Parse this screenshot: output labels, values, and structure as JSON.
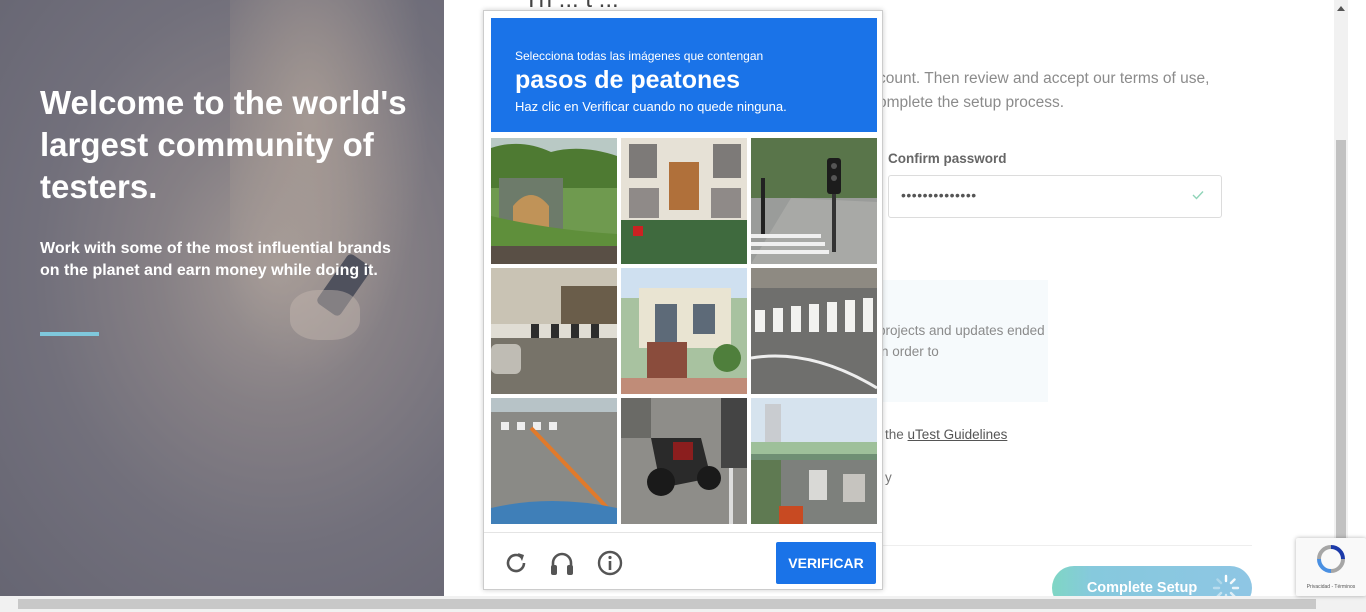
{
  "hero": {
    "title": "Welcome to the world's largest community of testers.",
    "subtitle": "Work with some of the most influential brands on the planet and earn money while doing it."
  },
  "form": {
    "heading_fragment": "Th ... t ...",
    "intro": "count. Then review and accept our terms of use, omplete the setup process.",
    "confirm_password_label": "Confirm password",
    "confirm_password_value": "••••••••••••••",
    "info_text": "projects and updates ended in order to",
    "guidelines_prefix": "the",
    "guidelines_link": "uTest Guidelines",
    "fragment_y": "y",
    "complete_button": "Complete Setup"
  },
  "captcha": {
    "instruction_small": "Selecciona todas las imágenes que contengan",
    "instruction_target": "pasos de peatones",
    "instruction_hint": "Haz clic en Verificar cuando no quede ninguna.",
    "verify_label": "VERIFICAR",
    "tiles": [
      "tunnel-hill-tile",
      "house-door-tile",
      "traffic-light-crossing-tile",
      "road-barrier-tile",
      "house-steps-tile",
      "zebra-crossing-tile",
      "street-lanes-tile",
      "motorcycle-tile",
      "overpass-traffic-tile"
    ]
  },
  "recaptcha_badge": {
    "terms": "Privacidad - Términos"
  },
  "colors": {
    "captcha_blue": "#1a73e8",
    "hero_rule": "#7fc8dc",
    "button_gradient_start": "#7fd6c4",
    "button_gradient_end": "#8ec6e4"
  }
}
